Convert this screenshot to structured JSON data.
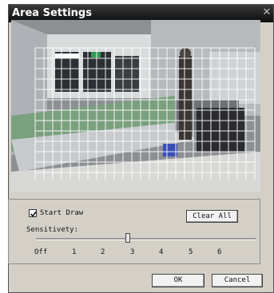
{
  "dialog": {
    "title": "Area Settings",
    "close_icon": "close-icon",
    "video_frame": {
      "grid_cols": 25,
      "grid_rows": 12
    }
  },
  "controls": {
    "start_draw": {
      "label": "Start Draw",
      "checked": true
    },
    "clear_all_label": "Clear All",
    "sensitivity_label": "Sensitivety:",
    "sensitivity_value": 3,
    "scale": [
      "Off",
      "1",
      "2",
      "3",
      "4",
      "5",
      "6"
    ]
  },
  "footer": {
    "ok_label": "OK",
    "cancel_label": "Cancel"
  }
}
